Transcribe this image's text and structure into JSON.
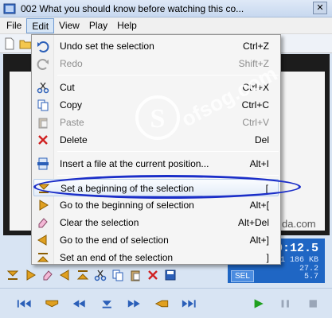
{
  "window": {
    "title": "002 What you should know before watching this co..."
  },
  "menubar": [
    "File",
    "Edit",
    "View",
    "Play",
    "Help"
  ],
  "menu": {
    "items": [
      {
        "label": "Undo set the selection",
        "shortcut": "Ctrl+Z",
        "icon": "undo-icon"
      },
      {
        "label": "Redo",
        "shortcut": "Shift+Z",
        "icon": "redo-icon",
        "disabled": true
      },
      {
        "label": "Cut",
        "shortcut": "Ctrl+X",
        "icon": "scissors-icon"
      },
      {
        "label": "Copy",
        "shortcut": "Ctrl+C",
        "icon": "copy-icon"
      },
      {
        "label": "Paste",
        "shortcut": "Ctrl+V",
        "icon": "paste-icon",
        "disabled": true
      },
      {
        "label": "Delete",
        "shortcut": "Del",
        "icon": "delete-icon"
      },
      {
        "label": "Insert a file at the current position...",
        "shortcut": "Alt+I",
        "icon": "insert-file-icon"
      },
      {
        "label": "Set a beginning of the selection",
        "shortcut": "[",
        "icon": "selection-begin-icon"
      },
      {
        "label": "Go to the beginning of selection",
        "shortcut": "Alt+[",
        "icon": "go-begin-icon"
      },
      {
        "label": "Clear the selection",
        "shortcut": "Alt+Del",
        "icon": "clear-selection-icon"
      },
      {
        "label": "Go to the end of selection",
        "shortcut": "Alt+]",
        "icon": "go-end-icon"
      },
      {
        "label": "Set an end of the selection",
        "shortcut": "]",
        "icon": "selection-end-icon"
      }
    ]
  },
  "video": {
    "watermark_partial": "da.com"
  },
  "timer": {
    "time": "0:12.5",
    "kb": "1 186 KB",
    "v1": "27.2",
    "v2": "5.7",
    "sel": "SEL"
  },
  "watermark": "Sofsog.com",
  "colors": {
    "accent": "#1f66c4",
    "ring": "#1b2ec8",
    "icon_orange": "#e0a020",
    "icon_blue": "#2b5fb8",
    "icon_red": "#d02020",
    "icon_green": "#1fa01f"
  }
}
